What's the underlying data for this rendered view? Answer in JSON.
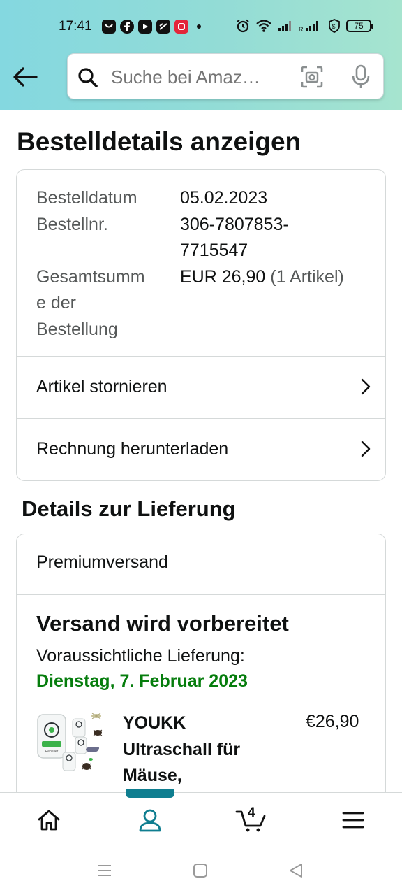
{
  "status_bar": {
    "time": "17:41",
    "battery": "75",
    "notification_icons": [
      "mail-app-icon",
      "facebook-icon",
      "youtube-icon",
      "app-icon",
      "red-app-icon"
    ],
    "system_icons": [
      "alarm-icon",
      "wifi-icon",
      "signal-icon",
      "signal-roaming-icon",
      "vpn-icon",
      "battery-icon"
    ]
  },
  "header": {
    "search_placeholder": "Suche bei Amaz…",
    "colors": {
      "gradient_start": "#84d8e0",
      "gradient_end": "#a6e4cf"
    }
  },
  "page": {
    "title": "Bestelldetails anzeigen"
  },
  "order": {
    "date_label": "Bestelldatum",
    "date_value": "05.02.2023",
    "number_label": "Bestellnr.",
    "number_value_line1": "306-7807853-",
    "number_value_line2": "7715547",
    "total_label_line1": "Gesamtsumm",
    "total_label_line2": "e der",
    "total_label_line3": "Bestellung",
    "total_value": "EUR 26,90",
    "total_items": "(1 Artikel)",
    "cancel_label": "Artikel stornieren",
    "invoice_label": "Rechnung herunterladen"
  },
  "delivery": {
    "section_title": "Details zur Lieferung",
    "method": "Premiumversand",
    "status": "Versand wird vorbereitet",
    "expected_label": "Voraussichtliche Lieferung:",
    "expected_date": "Dienstag, 7. Februar 2023",
    "product": {
      "name_line1": "YOUKK",
      "name_line2": "Ultraschall für",
      "name_line3": "Mäuse,",
      "price": "€26,90",
      "image_label": "Repeller"
    },
    "colors": {
      "date_green": "#067d0d"
    }
  },
  "bottom_nav": {
    "cart_count": "4",
    "items": [
      "home-icon",
      "account-icon",
      "cart-icon",
      "menu-icon"
    ],
    "active": "account-icon",
    "colors": {
      "active": "#0f7e90"
    }
  }
}
